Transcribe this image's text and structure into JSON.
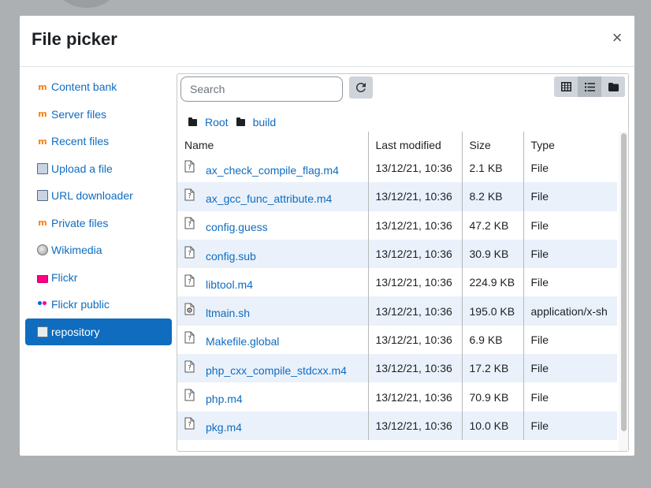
{
  "dialog": {
    "title": "File picker",
    "close_icon": "×"
  },
  "sidebar": {
    "items": [
      {
        "label": "Content bank",
        "icon": "moodle-icon",
        "active": false
      },
      {
        "label": "Server files",
        "icon": "moodle-icon",
        "active": false
      },
      {
        "label": "Recent files",
        "icon": "moodle-icon",
        "active": false
      },
      {
        "label": "Upload a file",
        "icon": "upload-icon",
        "active": false
      },
      {
        "label": "URL downloader",
        "icon": "upload-icon",
        "active": false
      },
      {
        "label": "Private files",
        "icon": "moodle-icon",
        "active": false
      },
      {
        "label": "Wikimedia",
        "icon": "wikimedia-icon",
        "active": false
      },
      {
        "label": "Flickr",
        "icon": "flickr-icon",
        "active": false
      },
      {
        "label": "Flickr public",
        "icon": "flickr-public-icon",
        "active": false
      },
      {
        "label": "repository",
        "icon": "repository-icon",
        "active": true
      }
    ]
  },
  "toolbar": {
    "search_placeholder": "Search",
    "refresh_icon": "↻"
  },
  "breadcrumb": {
    "items": [
      "Root",
      "build"
    ]
  },
  "table": {
    "headers": [
      "Name",
      "Last modified",
      "Size",
      "Type"
    ],
    "rows": [
      {
        "name": "ax_check_compile_flag.m4",
        "modified": "13/12/21, 10:36",
        "size": "2.1 KB",
        "type": "File",
        "icon": "file-unknown-icon"
      },
      {
        "name": "ax_gcc_func_attribute.m4",
        "modified": "13/12/21, 10:36",
        "size": "8.2 KB",
        "type": "File",
        "icon": "file-unknown-icon"
      },
      {
        "name": "config.guess",
        "modified": "13/12/21, 10:36",
        "size": "47.2 KB",
        "type": "File",
        "icon": "file-unknown-icon"
      },
      {
        "name": "config.sub",
        "modified": "13/12/21, 10:36",
        "size": "30.9 KB",
        "type": "File",
        "icon": "file-unknown-icon"
      },
      {
        "name": "libtool.m4",
        "modified": "13/12/21, 10:36",
        "size": "224.9 KB",
        "type": "File",
        "icon": "file-unknown-icon"
      },
      {
        "name": "ltmain.sh",
        "modified": "13/12/21, 10:36",
        "size": "195.0 KB",
        "type": "application/x-sh",
        "icon": "file-script-icon"
      },
      {
        "name": "Makefile.global",
        "modified": "13/12/21, 10:36",
        "size": "6.9 KB",
        "type": "File",
        "icon": "file-unknown-icon"
      },
      {
        "name": "php_cxx_compile_stdcxx.m4",
        "modified": "13/12/21, 10:36",
        "size": "17.2 KB",
        "type": "File",
        "icon": "file-unknown-icon"
      },
      {
        "name": "php.m4",
        "modified": "13/12/21, 10:36",
        "size": "70.9 KB",
        "type": "File",
        "icon": "file-unknown-icon"
      },
      {
        "name": "pkg.m4",
        "modified": "13/12/21, 10:36",
        "size": "10.0 KB",
        "type": "File",
        "icon": "file-unknown-icon"
      }
    ]
  },
  "colors": {
    "accent": "#0f6cbf",
    "row_alt": "#eaf1fb"
  }
}
